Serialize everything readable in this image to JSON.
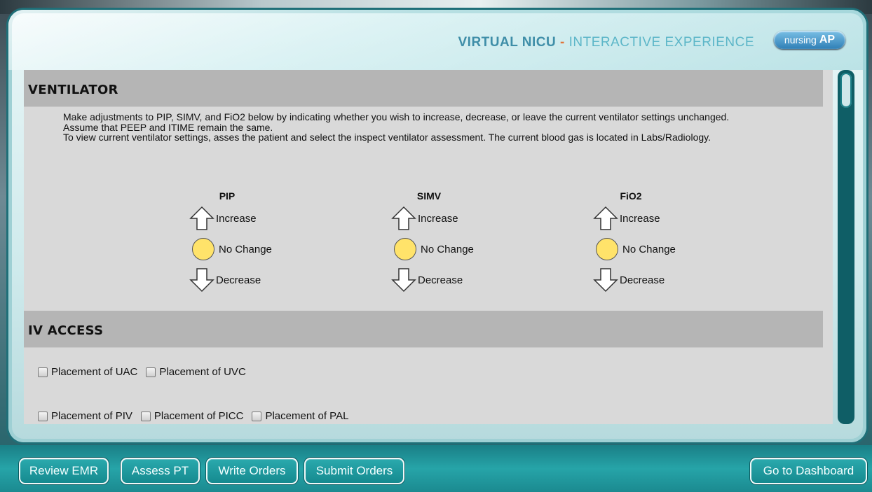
{
  "header": {
    "title_main": "VIRTUAL NICU",
    "title_dash": " - ",
    "title_sub": "INTERACTIVE EXPERIENCE",
    "logo_text": "nursing",
    "logo_badge": "AP"
  },
  "ventilator": {
    "heading": "VENTILATOR",
    "instructions": [
      "Make adjustments to PIP, SIMV, and FiO2 below by indicating whether you wish to increase, decrease, or leave the current ventilator settings unchanged.",
      "Assume that PEEP and ITIME remain the same.",
      "To view current ventilator settings, asses the patient and select the inspect ventilator assessment. The current blood gas is located in Labs/Radiology."
    ],
    "settings": [
      {
        "name": "PIP",
        "increase": "Increase",
        "no_change": "No Change",
        "decrease": "Decrease"
      },
      {
        "name": "SIMV",
        "increase": "Increase",
        "no_change": "No Change",
        "decrease": "Decrease"
      },
      {
        "name": "FiO2",
        "increase": "Increase",
        "no_change": "No Change",
        "decrease": "Decrease"
      }
    ],
    "colors": {
      "no_change_selected": "#ffe36a"
    }
  },
  "iv_access": {
    "heading": "IV ACCESS",
    "row1": [
      "Placement of UAC",
      "Placement of UVC"
    ],
    "row2": [
      "Placement of PIV",
      "Placement of PICC",
      "Placement of PAL"
    ]
  },
  "footer": {
    "review_emr": "Review EMR",
    "assess_pt": "Assess PT",
    "write_orders": "Write Orders",
    "submit_orders": "Submit Orders",
    "go_dashboard": "Go to Dashboard"
  }
}
